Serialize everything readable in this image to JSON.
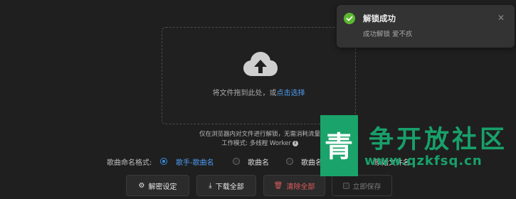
{
  "upload": {
    "hint_text": "将文件拖到此处，或",
    "hint_link": "点击选择"
  },
  "notes": {
    "line1": "仅在浏览器内对文件进行解锁，无需消耗流量",
    "line2": "工作模式: 多线程 Worker"
  },
  "naming": {
    "label": "歌曲命名格式:",
    "options": [
      "歌手-歌曲名",
      "歌曲名",
      "歌曲名",
      "原始文件名"
    ],
    "selected_index": 0
  },
  "buttons": {
    "decrypt_settings": "解密设定",
    "download_all": "下载全部",
    "clear_all": "清除全部",
    "save_now": "立即保存"
  },
  "toast": {
    "title": "解锁成功",
    "message": "成功解锁 爱不疚"
  },
  "watermark": {
    "badge_char": "青",
    "title": "争开放社区",
    "url": "www.qzkfsq.cn"
  },
  "colors": {
    "accent": "#3a8ee6",
    "success": "#5bb830",
    "danger": "#e05a5a",
    "watermark": "#1aa36a"
  }
}
